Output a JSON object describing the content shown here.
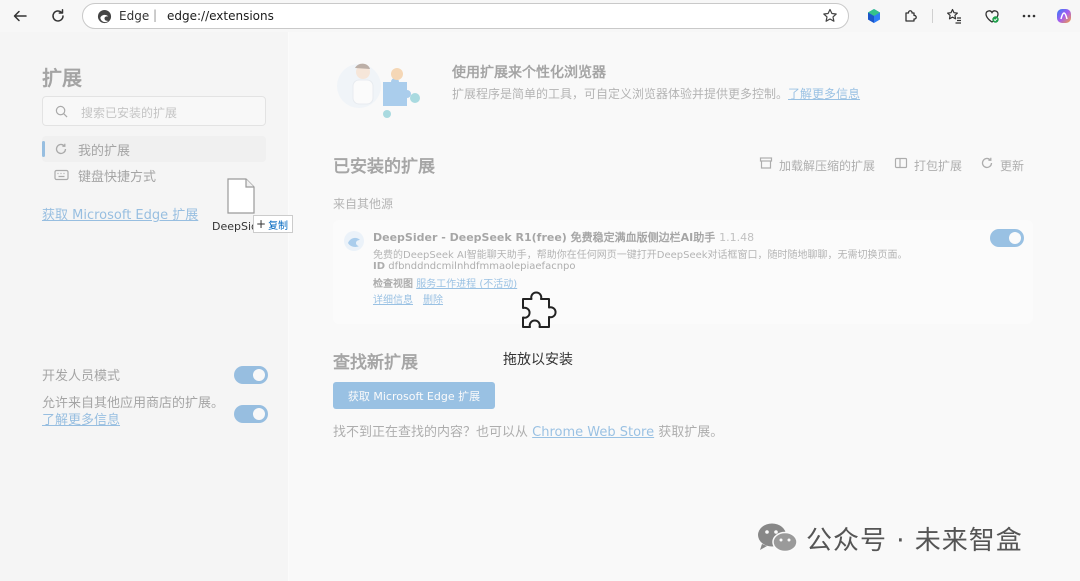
{
  "address_bar": {
    "site_label": "Edge",
    "separator": "|",
    "url": "edge://extensions"
  },
  "sidebar": {
    "title": "扩展",
    "search_placeholder": "搜索已安装的扩展",
    "items": [
      {
        "label": "我的扩展"
      },
      {
        "label": "键盘快捷方式"
      }
    ],
    "store_link": "获取 Microsoft Edge 扩展",
    "developer_mode": {
      "label": "开发人员模式",
      "on": true
    },
    "allow_other_stores": {
      "label": "允许来自其他应用商店的扩展。",
      "link": "了解更多信息",
      "on": true
    }
  },
  "hero": {
    "title": "使用扩展来个性化浏览器",
    "description": "扩展程序是简单的工具，可自定义浏览器体验并提供更多控制。",
    "link": "了解更多信息"
  },
  "installed": {
    "title": "已安装的扩展",
    "actions": [
      {
        "label": "加载解压缩的扩展"
      },
      {
        "label": "打包扩展"
      },
      {
        "label": "更新"
      }
    ],
    "source_heading": "来自其他源",
    "extension": {
      "name": "DeepSider - DeepSeek R1(free) 免费稳定满血版侧边栏AI助手",
      "version": "1.1.48",
      "description": "免费的DeepSeek AI智能聊天助手，帮助你在任何网页一键打开DeepSeek对话框窗口，随时随地聊聊，无需切换页面。",
      "id_label": "ID",
      "id": "dfbnddndcmilnhdfmmaolepiaefacnpo",
      "inspect_label": "检查视图",
      "inspect_link": "服务工作进程 (不活动)",
      "details": "详细信息",
      "remove": "删除",
      "enabled": true
    }
  },
  "find_new": {
    "title": "查找新扩展",
    "button": "获取 Microsoft Edge 扩展",
    "text_before": "找不到正在查找的内容？也可以从",
    "link": "Chrome Web Store",
    "text_after": "获取扩展。"
  },
  "drop_overlay": {
    "label": "拖放以安装"
  },
  "drag_ghost": {
    "file_name": "DeepSider",
    "copy_label": "复制"
  },
  "watermark": {
    "text": "公众号 · 未来智盒"
  },
  "colors": {
    "accent": "#0067c0"
  }
}
